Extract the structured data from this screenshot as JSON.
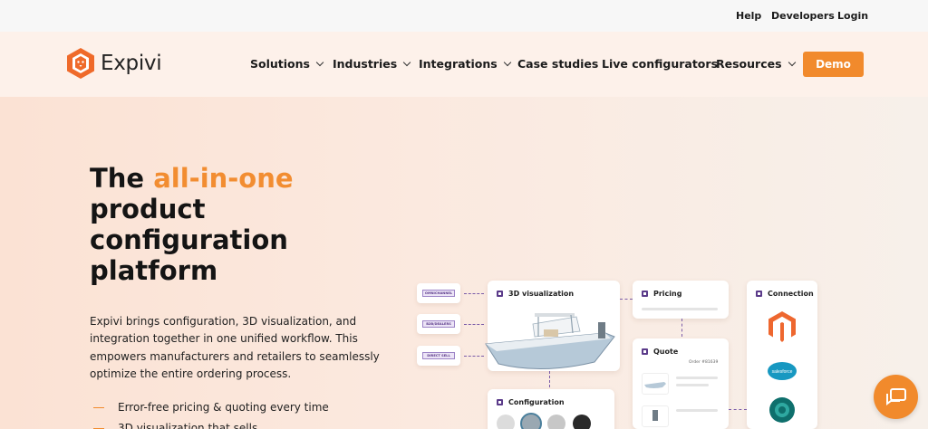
{
  "utility_nav": {
    "help": "Help",
    "developers": "Developers",
    "login": "Login"
  },
  "brand": {
    "name": "Expivi",
    "accent": "#f18a2c"
  },
  "main_nav": {
    "solutions": "Solutions",
    "industries": "Industries",
    "integrations": "Integrations",
    "case_studies": "Case studies",
    "live_configurators": "Live configurators",
    "resources": "Resources",
    "demo": "Demo"
  },
  "hero": {
    "headline_pre": "The ",
    "headline_accent": "all-in-one",
    "headline_post": " product configuration platform",
    "lead": "Expivi brings configuration, 3D visualization, and integration together in one unified workflow. This empowers manufacturers and retailers to seamlessly optimize the entire ordering process.",
    "bullets": [
      "Error-free pricing & quoting every time",
      "3D visualization that sells"
    ]
  },
  "diagram": {
    "tags": [
      "OMNICHANNEL",
      "B2B/DEALERS",
      "DIRECT SELL"
    ],
    "visualization_title": "3D visualization",
    "pricing_title": "Pricing",
    "quote_title": "Quote",
    "quote_order": "Order #81639",
    "configuration_title": "Configuration",
    "connection_title": "Connection",
    "connection_logos": [
      "magento-icon",
      "salesforce-icon",
      "dynamics-icon"
    ],
    "salesforce_label": "salesforce"
  },
  "chat": {
    "icon": "chat-icon"
  }
}
